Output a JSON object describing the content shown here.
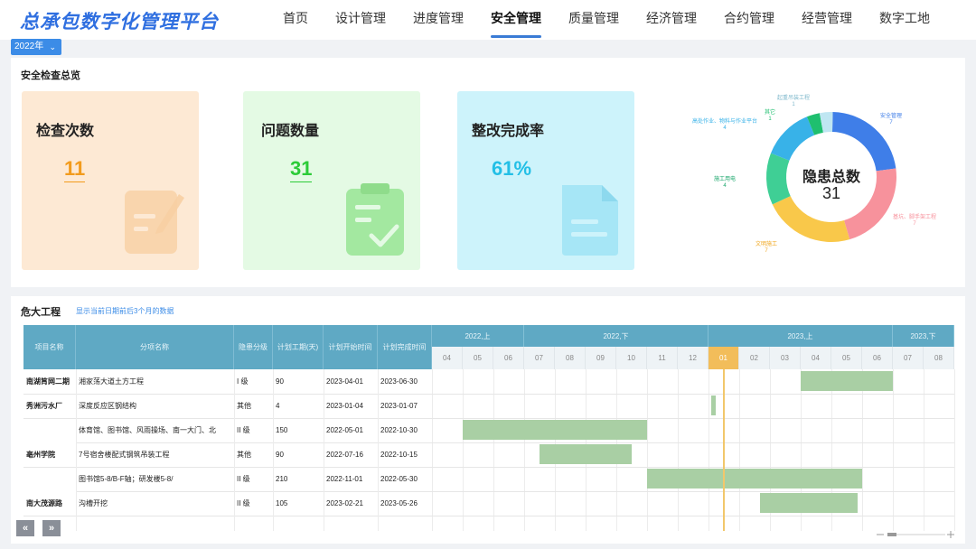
{
  "app": {
    "title": "总承包数字化管理平台"
  },
  "nav": {
    "items": [
      {
        "label": "首页"
      },
      {
        "label": "设计管理"
      },
      {
        "label": "进度管理"
      },
      {
        "label": "安全管理",
        "active": true
      },
      {
        "label": "质量管理"
      },
      {
        "label": "经济管理"
      },
      {
        "label": "合约管理"
      },
      {
        "label": "经营管理"
      },
      {
        "label": "数字工地"
      }
    ]
  },
  "year_select": {
    "value": "2022年"
  },
  "overview": {
    "title": "安全检查总览",
    "cards": [
      {
        "title": "检查次数",
        "value": "11",
        "color": "#f29b1c",
        "bg": "#fde9d4",
        "icon": "memo-icon"
      },
      {
        "title": "问题数量",
        "value": "31",
        "color": "#2ccb38",
        "bg": "#e4fae4",
        "icon": "clipboard-check-icon"
      },
      {
        "title": "整改完成率",
        "value": "61%",
        "color": "#23bfe6",
        "bg": "#cdf3fb",
        "icon": "document-icon"
      }
    ],
    "donut": {
      "center_title": "隐患总数",
      "center_value": "31",
      "slices": [
        {
          "name": "安全管理",
          "value": "7",
          "color": "#3f7ee8"
        },
        {
          "name": "基坑、脚手架工程",
          "value": "7",
          "color": "#f7929c"
        },
        {
          "name": "文明施工",
          "value": "7",
          "color": "#f9c84a"
        },
        {
          "name": "施工用电",
          "value": "4",
          "color": "#3fcf95"
        },
        {
          "name": "高处作业、物料与作业平台",
          "value": "4",
          "color": "#38b2e8"
        },
        {
          "name": "其它",
          "value": "1",
          "color": "#1fbf6f"
        },
        {
          "name": "起重吊装工程",
          "value": "1",
          "color": "#bfe6f2"
        }
      ]
    }
  },
  "gantt": {
    "title": "危大工程",
    "note": "显示当前日期前后3个月的数据",
    "columns": [
      "项目名称",
      "分项名称",
      "隐患分级",
      "计划工期(天)",
      "计划开始时间",
      "计划完成时间"
    ],
    "rows": [
      {
        "project": "南湖筲网二期",
        "item": "湘家荡大道土方工程",
        "level": "I 级",
        "duration": "90",
        "start": "2023-04-01",
        "end": "2023-06-30"
      },
      {
        "project": "秀洲污水厂",
        "item": "深度反应区钢结构",
        "level": "其他",
        "duration": "4",
        "start": "2023-01-04",
        "end": "2023-01-07"
      },
      {
        "project": "",
        "item": "体育馆、图书馆、风雨操场、南一大门、北",
        "level": "II 级",
        "duration": "150",
        "start": "2022-05-01",
        "end": "2022-10-30"
      },
      {
        "project": "亳州学院",
        "item": "7号宿舍楼配式钢筑吊装工程",
        "level": "其他",
        "duration": "90",
        "start": "2022-07-16",
        "end": "2022-10-15"
      },
      {
        "project": "",
        "item": "图书馆5-8/B-F轴；研发楼5-8/",
        "level": "II 级",
        "duration": "210",
        "start": "2022-11-01",
        "end": "2022-05-30"
      },
      {
        "project": "南大茂源路",
        "item": "沟槽开挖",
        "level": "II 级",
        "duration": "105",
        "start": "2023-02-21",
        "end": "2023-05-26"
      }
    ],
    "halves": [
      {
        "label": "2022,上"
      },
      {
        "label": "2022,下"
      },
      {
        "label": "2023,上"
      },
      {
        "label": "2023,下"
      }
    ],
    "months": [
      "04",
      "05",
      "06",
      "07",
      "08",
      "09",
      "10",
      "11",
      "12",
      "01",
      "02",
      "03",
      "04",
      "05",
      "06",
      "07",
      "08"
    ],
    "current_month": "01",
    "pager": {
      "prev": "«",
      "next": "»"
    }
  }
}
